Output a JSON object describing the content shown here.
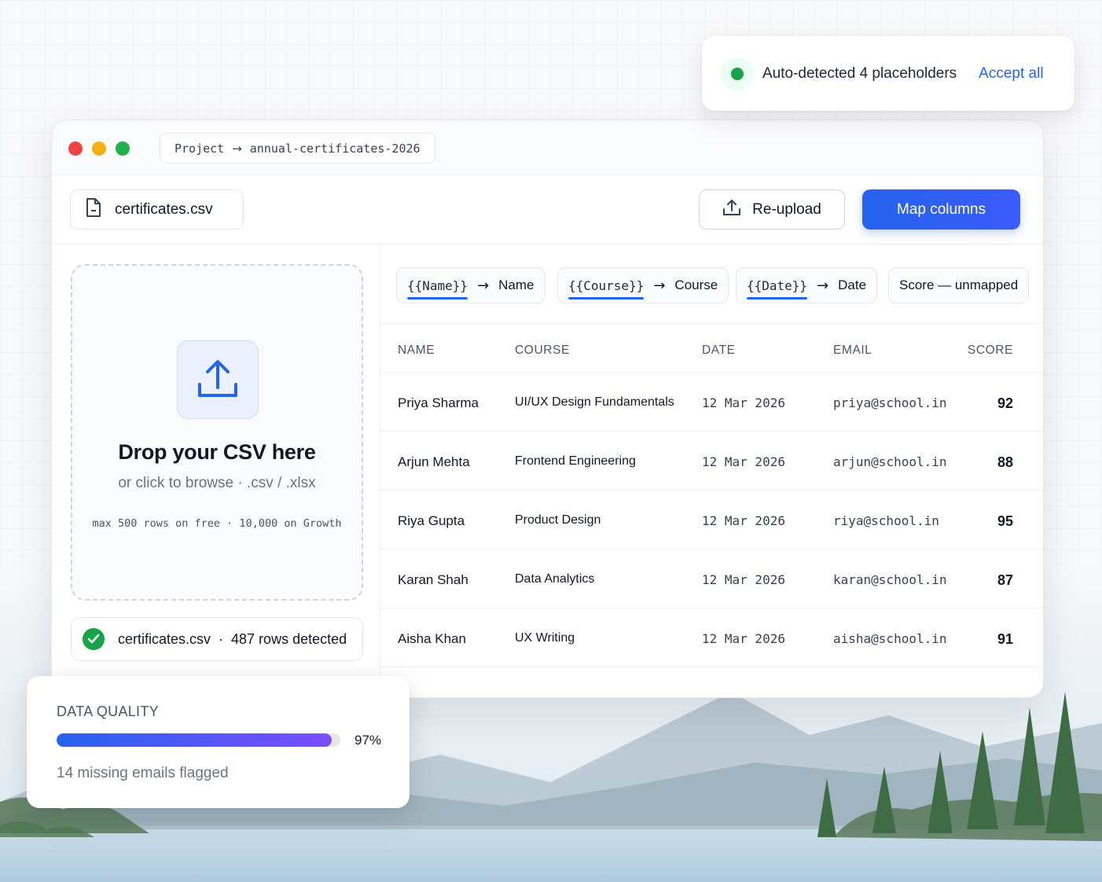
{
  "toast": {
    "message": "Auto-detected 4 placeholders",
    "action": "Accept all"
  },
  "window": {
    "breadcrumb": {
      "project": "Project",
      "name": "annual-certificates-2026"
    },
    "file_chip": "certificates.csv",
    "reupload_label": "Re-upload",
    "map_columns_label": "Map columns"
  },
  "dropzone": {
    "title": "Drop your CSV here",
    "subtitle": "or click to browse · .csv / .xlsx",
    "limit": "max 500 rows on free · 10,000 on Growth"
  },
  "status": {
    "file": "certificates.csv",
    "separator": "·",
    "rows": "487 rows detected"
  },
  "mappings": [
    {
      "placeholder": "{{Name}}",
      "column": "Name"
    },
    {
      "placeholder": "{{Course}}",
      "column": "Course"
    },
    {
      "placeholder": "{{Date}}",
      "column": "Date"
    },
    {
      "label": "Score — unmapped"
    }
  ],
  "table": {
    "headers": [
      "NAME",
      "COURSE",
      "DATE",
      "EMAIL",
      "SCORE"
    ],
    "rows": [
      {
        "name": "Priya Sharma",
        "course": "UI/UX Design Fundamentals",
        "date": "12 Mar 2026",
        "email": "priya@school.in",
        "score": "92"
      },
      {
        "name": "Arjun Mehta",
        "course": "Frontend Engineering",
        "date": "12 Mar 2026",
        "email": "arjun@school.in",
        "score": "88"
      },
      {
        "name": "Riya Gupta",
        "course": "Product Design",
        "date": "12 Mar 2026",
        "email": "riya@school.in",
        "score": "95"
      },
      {
        "name": "Karan Shah",
        "course": "Data Analytics",
        "date": "12 Mar 2026",
        "email": "karan@school.in",
        "score": "87"
      },
      {
        "name": "Aisha Khan",
        "course": "UX Writing",
        "date": "12 Mar 2026",
        "email": "aisha@school.in",
        "score": "91"
      }
    ]
  },
  "data_quality": {
    "title": "DATA QUALITY",
    "percent": 97,
    "percent_label": "97%",
    "note": "14 missing emails flagged"
  },
  "colors": {
    "accent": "#2563eb",
    "success": "#16a34a",
    "gradient_end": "#7c4dff"
  },
  "icons": {
    "file": "file-icon",
    "upload": "upload-icon",
    "check": "check-icon",
    "arrow": "arrow-right-icon"
  }
}
